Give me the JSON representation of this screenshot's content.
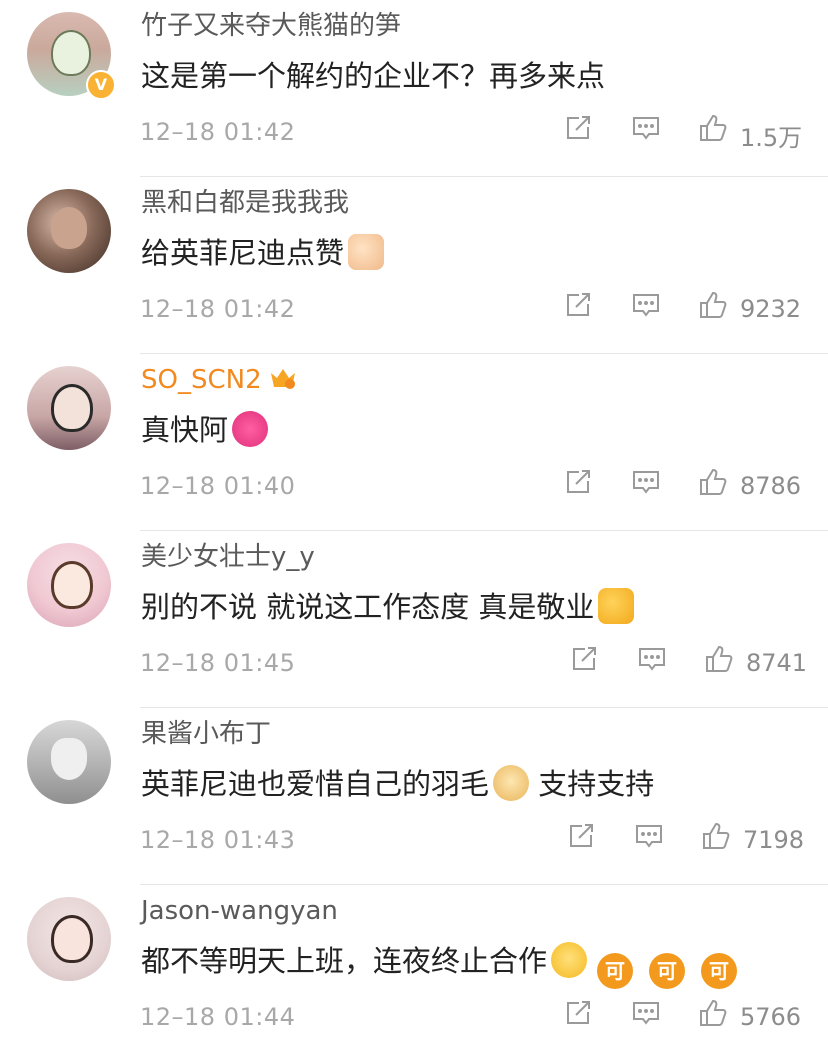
{
  "comments": [
    {
      "username": "竹子又来夺大熊猫的笋",
      "text": "这是第一个解约的企业不？再多来点",
      "time": "12–18 01:42",
      "likes": "1.5万",
      "verified": true,
      "vip": false,
      "emojis": []
    },
    {
      "username": "黑和白都是我我我",
      "text": "给英菲尼迪点赞",
      "time": "12–18 01:42",
      "likes": "9232",
      "verified": false,
      "vip": false,
      "emojis": [
        "thumbs-up-emoji"
      ]
    },
    {
      "username": "SO_SCN2",
      "text": "真快阿",
      "time": "12–18 01:40",
      "likes": "8786",
      "verified": false,
      "vip": true,
      "emojis": [
        "pink-monster-emoji"
      ]
    },
    {
      "username": "美少女壮士y_y",
      "text": "别的不说  就说这工作态度 真是敬业",
      "time": "12–18 01:45",
      "likes": "8741",
      "verified": false,
      "vip": false,
      "emojis": [
        "thumbs-up-emoji"
      ]
    },
    {
      "username": "果酱小布丁",
      "text_before": "英菲尼迪也爱惜自己的羽毛",
      "text_after": " 支持支持",
      "time": "12–18 01:43",
      "likes": "7198",
      "verified": false,
      "vip": false,
      "emojis": [
        "doge-emoji"
      ]
    },
    {
      "username": "Jason-wangyan",
      "text": "都不等明天上班，连夜终止合作",
      "time": "12–18 01:44",
      "likes": "5766",
      "verified": false,
      "vip": false,
      "emojis": [
        "laugh-cry-emoji",
        "ke-emoji",
        "ke-emoji",
        "ke-emoji"
      ],
      "ke_label": "可"
    }
  ],
  "colors": {
    "username": "#5a5a5a",
    "vip_username": "#f28a20",
    "text": "#222222",
    "meta": "#a8a8a8",
    "icon": "#9a9a9a"
  }
}
